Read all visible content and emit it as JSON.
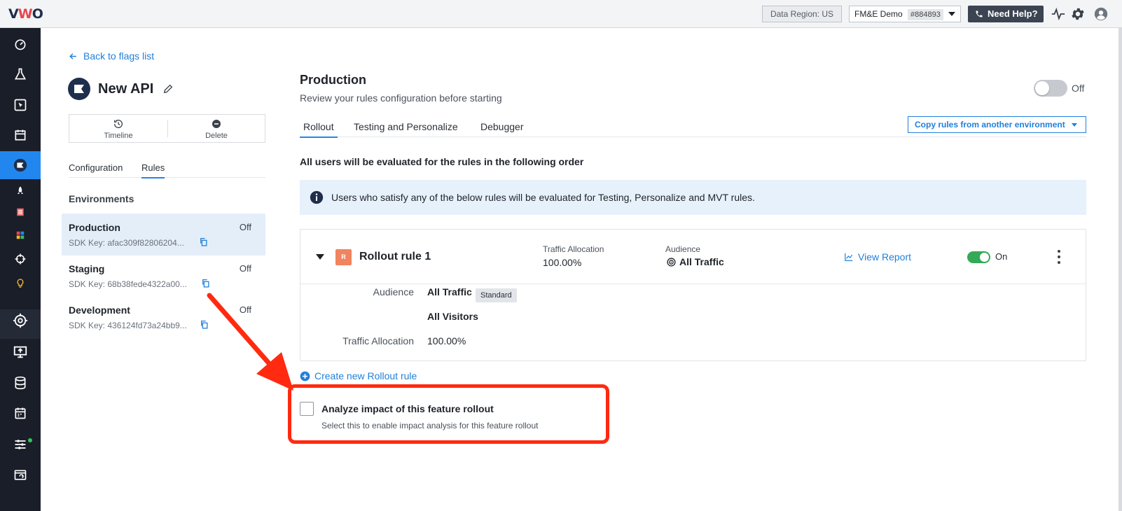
{
  "topbar": {
    "logo": "VWO",
    "data_region": "Data Region: US",
    "account_name": "FM&E Demo",
    "account_id": "#884893",
    "help_label": "Need Help?"
  },
  "left": {
    "back_label": "Back to flags list",
    "flag_name": "New API",
    "actions": {
      "timeline": "Timeline",
      "delete": "Delete"
    },
    "tabs": {
      "configuration": "Configuration",
      "rules": "Rules"
    },
    "environments_title": "Environments",
    "environments": [
      {
        "name": "Production",
        "status": "Off",
        "sdk_key": "SDK Key:  afac309f82806204..."
      },
      {
        "name": "Staging",
        "status": "Off",
        "sdk_key": "SDK Key:  68b38fede4322a00..."
      },
      {
        "name": "Development",
        "status": "Off",
        "sdk_key": "SDK Key:  436124fd73a24bb9..."
      }
    ]
  },
  "main": {
    "title": "Production",
    "subtitle": "Review your rules configuration before starting",
    "env_toggle_label": "Off",
    "tabs": {
      "rollout": "Rollout",
      "testing": "Testing and Personalize",
      "debugger": "Debugger"
    },
    "copy_rules_label": "Copy rules from another environment",
    "order_text": "All users will be evaluated for the rules in the following order",
    "info_text": "Users who satisfy any of the below rules will be evaluated for Testing, Personalize and MVT rules.",
    "rule": {
      "badge": "R",
      "name": "Rollout rule 1",
      "traffic_label": "Traffic Allocation",
      "traffic_value": "100.00%",
      "audience_label": "Audience",
      "audience_value": "All Traffic",
      "view_report": "View Report",
      "toggle_label": "On",
      "details": {
        "audience_label": "Audience",
        "audience_value": "All Traffic",
        "audience_tag": "Standard",
        "visitors": "All Visitors",
        "traffic_label": "Traffic Allocation",
        "traffic_value": "100.00%"
      }
    },
    "create_rule_label": "Create new Rollout rule",
    "analyze": {
      "title": "Analyze impact of this feature rollout",
      "subtitle": "Select this to enable impact analysis for this feature rollout"
    }
  },
  "colors": {
    "accent": "#2187ee",
    "sidebar": "#1a1e29",
    "highlight": "#ff2a10",
    "toggle_on": "#34a957"
  },
  "icons": [
    "dashboard-icon",
    "flask-icon",
    "cursor-icon",
    "calendar-icon",
    "flag-icon",
    "rocket-icon",
    "list-icon",
    "grid-icon",
    "target-icon",
    "bulb-icon",
    "crosshair-icon",
    "present-icon",
    "database-icon",
    "schedule-icon",
    "sliders-icon",
    "browser-icon",
    "activity-icon",
    "gear-icon",
    "user-icon"
  ]
}
